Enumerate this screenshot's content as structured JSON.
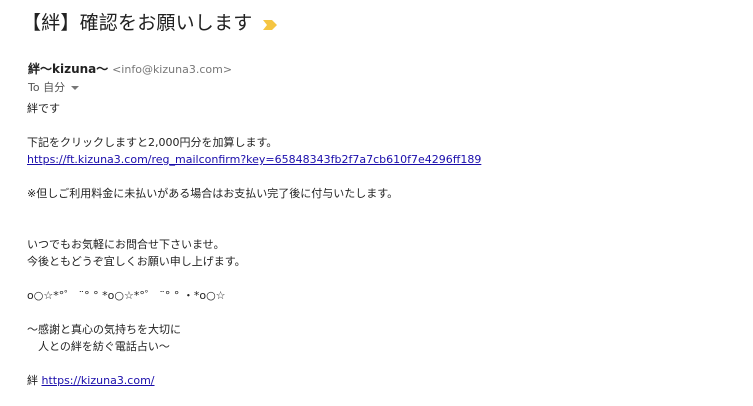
{
  "email": {
    "subject": "【絆】確認をお願いします",
    "importance_icon": "importance-marker-icon",
    "importance_color": "#f5c542",
    "sender": {
      "name": "絆～kizuna～",
      "email": "<info@kizuna3.com>"
    },
    "to_label": "To 自分",
    "body": {
      "greeting": "絆です",
      "instruction": "下記をクリックしますと2,000円分を加算します。",
      "confirm_link": "https://ft.kizuna3.com/reg_mailconfirm?key=65848343fb2f7a7cb610f7e4296ff189",
      "notice": "※但しご利用料金に未払いがある場合はお支払い完了後に付与いたします。",
      "closing_1": "いつでもお気軽にお問合せ下さいませ。",
      "closing_2": "今後ともどうぞ宜しくお願い申し上げます。",
      "decoration": "o○☆*°゜ ¨° ° *o○☆*°゜ ¨° ° ・*o○☆",
      "tagline_1": "～感謝と真心の気持ちを大切に",
      "tagline_2": "　人との絆を紡ぐ電話占い～",
      "signature_prefix": "絆",
      "site_link": "https://kizuna3.com/"
    }
  }
}
